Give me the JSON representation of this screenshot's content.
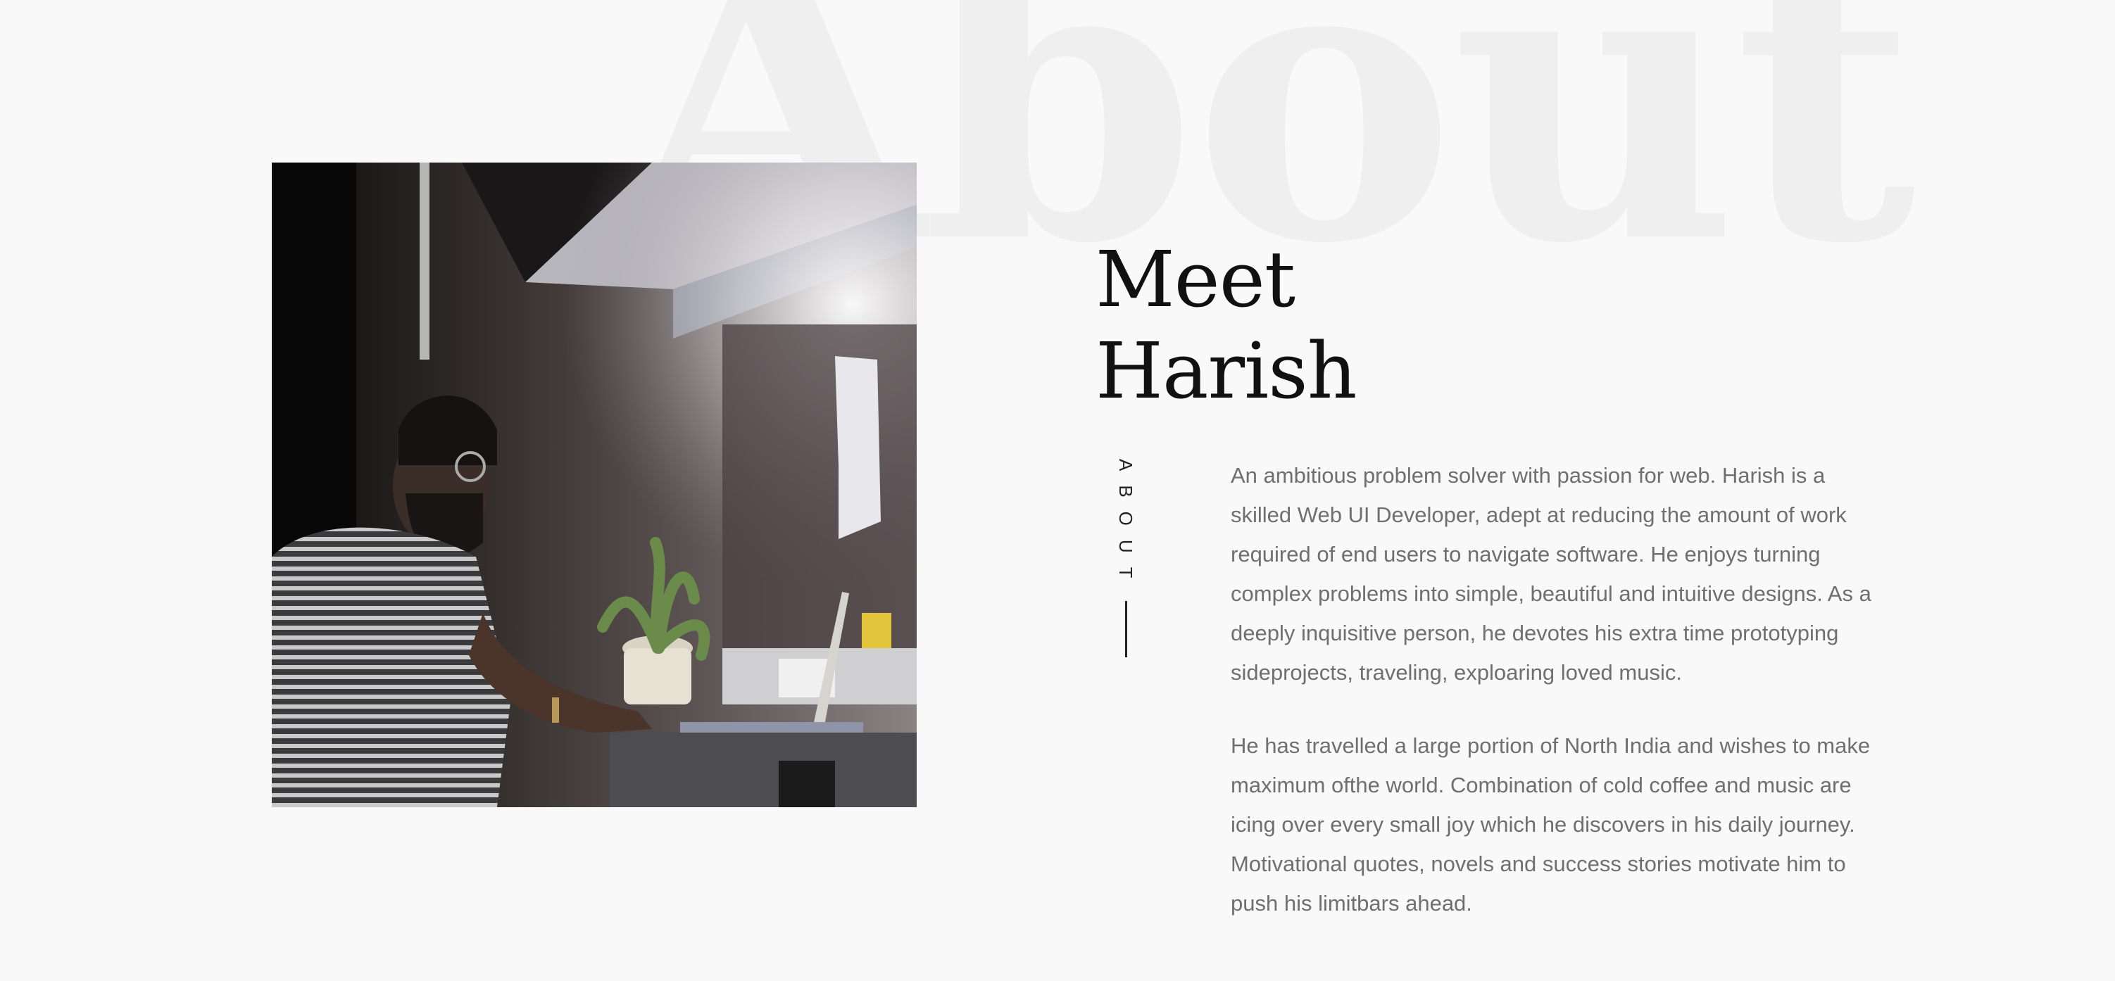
{
  "background_word": "About",
  "photo": {
    "alt": "Harish working on a laptop at a desk"
  },
  "heading": {
    "line1": "Meet",
    "line2": "Harish"
  },
  "side_label": "ABOUT",
  "bio": {
    "paragraphs": [
      "An ambitious problem solver with passion for web. Harish is a skilled Web UI Developer, adept at reducing the amount of work required of end users to navigate software. He enjoys turning complex problems into simple, beautiful and intuitive designs. As a deeply inquisitive person, he devotes his extra time prototyping sideprojects, traveling, exploaring loved music.",
      "He has travelled a large portion of North India and wishes to make maximum ofthe world. Combination of cold coffee and music are icing over every small joy which he discovers in his daily journey. Motivational quotes, novels and success stories motivate him to push his limitbars ahead."
    ]
  },
  "colors": {
    "background": "#f9f9f9",
    "background_word": "#efefef",
    "heading": "#111111",
    "body_text": "#6f6f6f"
  }
}
